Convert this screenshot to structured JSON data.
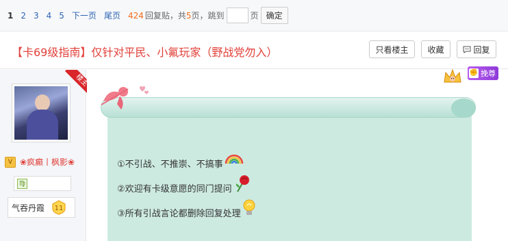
{
  "pager": {
    "pages": [
      "1",
      "2",
      "3",
      "4",
      "5"
    ],
    "next": "下一页",
    "last": "尾页",
    "reply_count": "424",
    "reply_suffix": "回复贴，共",
    "total_pages": "5",
    "pages_suffix": "页，",
    "jump_label": "跳到",
    "jump_unit": "页",
    "confirm": "确定"
  },
  "thread": {
    "title": "【卡69级指南】仅针对平民、小氟玩家（野战党勿入）",
    "only_op": "只看楼主",
    "favorite": "收藏",
    "reply": "回复"
  },
  "author": {
    "ribbon": "楼主",
    "name": "❀疯癫丨枫影❀",
    "medal_char": "♍",
    "level_title": "气吞丹霞",
    "level_num": "11"
  },
  "post": {
    "badge_label": "挽尊",
    "rules": [
      "①不引战、不推崇、不搞事",
      "②欢迎有卡级意愿的同门提问",
      "③所有引战言论都删除回复处理"
    ],
    "icons": [
      "rainbow-icon",
      "rose-icon",
      "lightbulb-icon"
    ]
  },
  "colors": {
    "title_red": "#e1403a",
    "link_blue": "#2d64b3",
    "count_orange": "#f26c1a",
    "scroll_green": "#cdeae1",
    "badge_purple": "#a44be6"
  }
}
